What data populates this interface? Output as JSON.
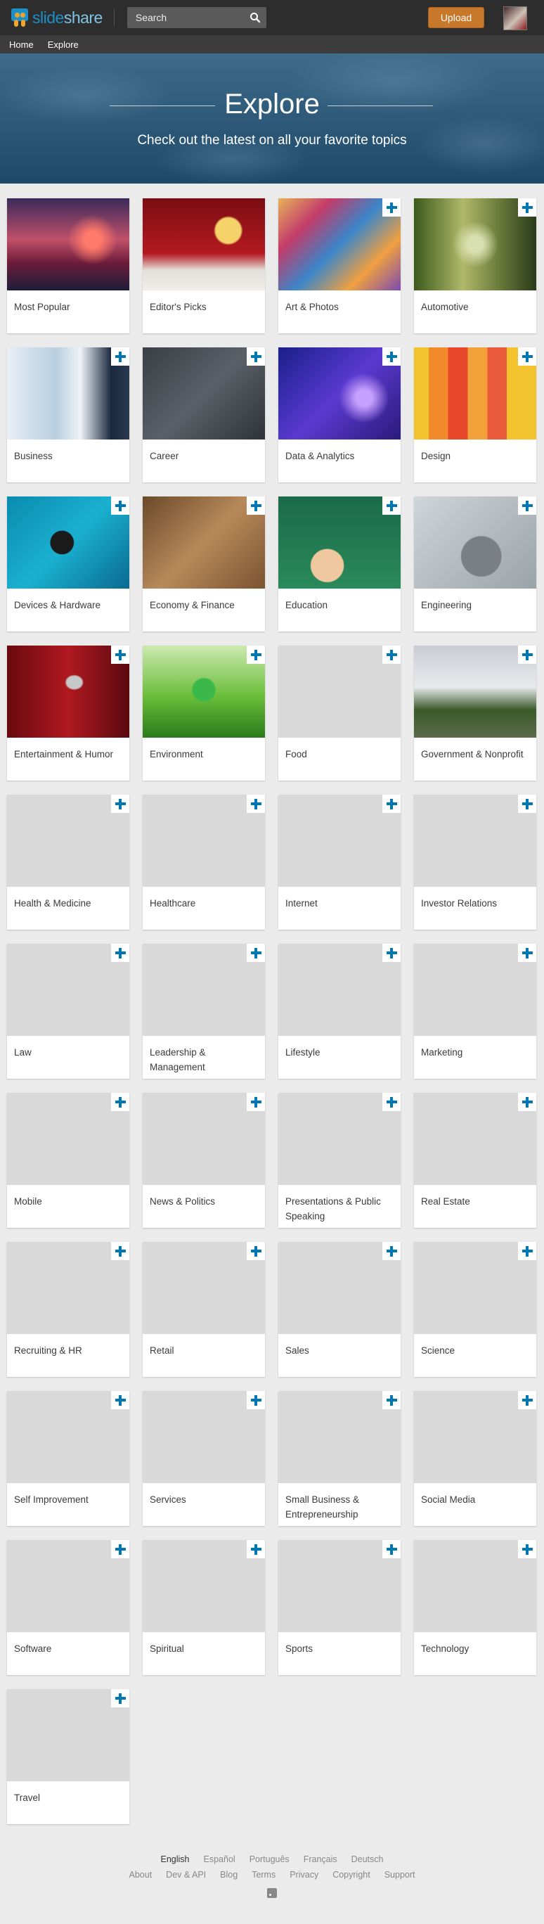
{
  "header": {
    "logo_text_a": "slide",
    "logo_text_b": "share",
    "search_placeholder": "Search",
    "upload_label": "Upload"
  },
  "subnav": [
    "Home",
    "Explore"
  ],
  "hero": {
    "title": "Explore",
    "subtitle": "Check out the latest on all your favorite topics"
  },
  "categories": [
    {
      "label": "Most Popular",
      "thumb": "photo",
      "plus": false
    },
    {
      "label": "Editor's Picks",
      "thumb": "photo",
      "plus": false
    },
    {
      "label": "Art & Photos",
      "thumb": "photo",
      "plus": true
    },
    {
      "label": "Automotive",
      "thumb": "photo",
      "plus": true
    },
    {
      "label": "Business",
      "thumb": "photo",
      "plus": true
    },
    {
      "label": "Career",
      "thumb": "photo",
      "plus": true
    },
    {
      "label": "Data & Analytics",
      "thumb": "photo",
      "plus": true
    },
    {
      "label": "Design",
      "thumb": "photo",
      "plus": true
    },
    {
      "label": "Devices & Hardware",
      "thumb": "photo",
      "plus": true
    },
    {
      "label": "Economy & Finance",
      "thumb": "photo",
      "plus": true
    },
    {
      "label": "Education",
      "thumb": "photo",
      "plus": true
    },
    {
      "label": "Engineering",
      "thumb": "photo",
      "plus": true
    },
    {
      "label": "Entertainment & Humor",
      "thumb": "photo",
      "plus": true
    },
    {
      "label": "Environment",
      "thumb": "photo",
      "plus": true
    },
    {
      "label": "Food",
      "thumb": "blank",
      "plus": true
    },
    {
      "label": "Government & Nonprofit",
      "thumb": "photo",
      "plus": true
    },
    {
      "label": "Health & Medicine",
      "thumb": "blank",
      "plus": true
    },
    {
      "label": "Healthcare",
      "thumb": "blank",
      "plus": true
    },
    {
      "label": "Internet",
      "thumb": "blank",
      "plus": true
    },
    {
      "label": "Investor Relations",
      "thumb": "blank",
      "plus": true
    },
    {
      "label": "Law",
      "thumb": "blank",
      "plus": true
    },
    {
      "label": "Leadership & Management",
      "thumb": "blank",
      "plus": true
    },
    {
      "label": "Lifestyle",
      "thumb": "blank",
      "plus": true
    },
    {
      "label": "Marketing",
      "thumb": "blank",
      "plus": true
    },
    {
      "label": "Mobile",
      "thumb": "blank",
      "plus": true
    },
    {
      "label": "News & Politics",
      "thumb": "blank",
      "plus": true
    },
    {
      "label": "Presentations & Public Speaking",
      "thumb": "blank",
      "plus": true
    },
    {
      "label": "Real Estate",
      "thumb": "blank",
      "plus": true
    },
    {
      "label": "Recruiting & HR",
      "thumb": "blank",
      "plus": true
    },
    {
      "label": "Retail",
      "thumb": "blank",
      "plus": true
    },
    {
      "label": "Sales",
      "thumb": "blank",
      "plus": true
    },
    {
      "label": "Science",
      "thumb": "blank",
      "plus": true
    },
    {
      "label": "Self Improvement",
      "thumb": "blank",
      "plus": true
    },
    {
      "label": "Services",
      "thumb": "blank",
      "plus": true
    },
    {
      "label": "Small Business & Entrepreneurship",
      "thumb": "blank",
      "plus": true
    },
    {
      "label": "Social Media",
      "thumb": "blank",
      "plus": true
    },
    {
      "label": "Software",
      "thumb": "blank",
      "plus": true
    },
    {
      "label": "Spiritual",
      "thumb": "blank",
      "plus": true
    },
    {
      "label": "Sports",
      "thumb": "blank",
      "plus": true
    },
    {
      "label": "Technology",
      "thumb": "blank",
      "plus": true
    },
    {
      "label": "Travel",
      "thumb": "blank",
      "plus": true
    }
  ],
  "footer": {
    "languages": [
      "English",
      "Español",
      "Português",
      "Français",
      "Deutsch"
    ],
    "links": [
      "About",
      "Dev & API",
      "Blog",
      "Terms",
      "Privacy",
      "Copyright",
      "Support"
    ]
  },
  "colors": {
    "accent_blue": "#0077b5",
    "upload_orange": "#c8782a",
    "topbar": "#2d2d2d"
  }
}
